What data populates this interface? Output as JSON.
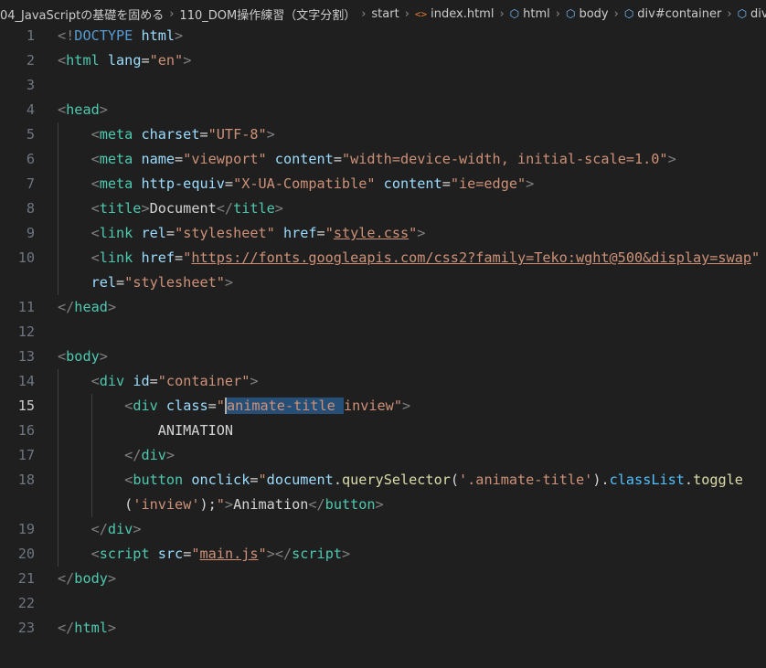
{
  "breadcrumb": [
    {
      "label": "04_JavaScriptの基礎を固める",
      "icon": ""
    },
    {
      "label": "110_DOM操作練習（文字分割）",
      "icon": ""
    },
    {
      "label": "start",
      "icon": ""
    },
    {
      "label": "index.html",
      "icon": "html-file-icon"
    },
    {
      "label": "html",
      "icon": "element-icon"
    },
    {
      "label": "body",
      "icon": "element-icon"
    },
    {
      "label": "div#container",
      "icon": "element-icon"
    },
    {
      "label": "div.animate-title",
      "icon": "element-icon"
    }
  ],
  "colors": {
    "background": "#1f1f1f",
    "tag": "#4ec9b0",
    "attribute": "#9cdcfe",
    "string": "#ce9178",
    "punctuation": "#808080",
    "selection": "#264f78"
  },
  "lines": [
    {
      "num": "1",
      "tokens": [
        [
          "punc",
          "<!"
        ],
        [
          "doc",
          "DOCTYPE"
        ],
        [
          "text",
          " "
        ],
        [
          "attr",
          "html"
        ],
        [
          "punc",
          ">"
        ]
      ]
    },
    {
      "num": "2",
      "tokens": [
        [
          "punc",
          "<"
        ],
        [
          "tag",
          "html"
        ],
        [
          "text",
          " "
        ],
        [
          "attr",
          "lang"
        ],
        [
          "text",
          "="
        ],
        [
          "str",
          "\"en\""
        ],
        [
          "punc",
          ">"
        ]
      ]
    },
    {
      "num": "3",
      "tokens": []
    },
    {
      "num": "4",
      "tokens": [
        [
          "punc",
          "<"
        ],
        [
          "tag",
          "head"
        ],
        [
          "punc",
          ">"
        ]
      ]
    },
    {
      "num": "5",
      "tokens": [
        [
          "text",
          "    "
        ],
        [
          "punc",
          "<"
        ],
        [
          "tag",
          "meta"
        ],
        [
          "text",
          " "
        ],
        [
          "attr",
          "charset"
        ],
        [
          "text",
          "="
        ],
        [
          "str",
          "\"UTF-8\""
        ],
        [
          "punc",
          ">"
        ]
      ]
    },
    {
      "num": "6",
      "tokens": [
        [
          "text",
          "    "
        ],
        [
          "punc",
          "<"
        ],
        [
          "tag",
          "meta"
        ],
        [
          "text",
          " "
        ],
        [
          "attr",
          "name"
        ],
        [
          "text",
          "="
        ],
        [
          "str",
          "\"viewport\""
        ],
        [
          "text",
          " "
        ],
        [
          "attr",
          "content"
        ],
        [
          "text",
          "="
        ],
        [
          "str",
          "\"width=device-width, initial-scale=1.0\""
        ],
        [
          "punc",
          ">"
        ]
      ]
    },
    {
      "num": "7",
      "tokens": [
        [
          "text",
          "    "
        ],
        [
          "punc",
          "<"
        ],
        [
          "tag",
          "meta"
        ],
        [
          "text",
          " "
        ],
        [
          "attr",
          "http-equiv"
        ],
        [
          "text",
          "="
        ],
        [
          "str",
          "\"X-UA-Compatible\""
        ],
        [
          "text",
          " "
        ],
        [
          "attr",
          "content"
        ],
        [
          "text",
          "="
        ],
        [
          "str",
          "\"ie=edge\""
        ],
        [
          "punc",
          ">"
        ]
      ]
    },
    {
      "num": "8",
      "tokens": [
        [
          "text",
          "    "
        ],
        [
          "punc",
          "<"
        ],
        [
          "tag",
          "title"
        ],
        [
          "punc",
          ">"
        ],
        [
          "text",
          "Document"
        ],
        [
          "punc",
          "</"
        ],
        [
          "tag",
          "title"
        ],
        [
          "punc",
          ">"
        ]
      ]
    },
    {
      "num": "9",
      "tokens": [
        [
          "text",
          "    "
        ],
        [
          "punc",
          "<"
        ],
        [
          "tag",
          "link"
        ],
        [
          "text",
          " "
        ],
        [
          "attr",
          "rel"
        ],
        [
          "text",
          "="
        ],
        [
          "str",
          "\"stylesheet\""
        ],
        [
          "text",
          " "
        ],
        [
          "attr",
          "href"
        ],
        [
          "text",
          "="
        ],
        [
          "str",
          "\""
        ],
        [
          "strlink",
          "style.css"
        ],
        [
          "str",
          "\""
        ],
        [
          "punc",
          ">"
        ]
      ]
    },
    {
      "num": "10",
      "tokens": [
        [
          "text",
          "    "
        ],
        [
          "punc",
          "<"
        ],
        [
          "tag",
          "link"
        ],
        [
          "text",
          " "
        ],
        [
          "attr",
          "href"
        ],
        [
          "text",
          "="
        ],
        [
          "str",
          "\""
        ],
        [
          "strlink",
          "https://fonts.googleapis.com/css2?family=Teko:wght@500&display=swap"
        ],
        [
          "str",
          "\""
        ]
      ]
    },
    {
      "num": "",
      "tokens": [
        [
          "text",
          "    "
        ],
        [
          "attr",
          "rel"
        ],
        [
          "text",
          "="
        ],
        [
          "str",
          "\"stylesheet\""
        ],
        [
          "punc",
          ">"
        ]
      ]
    },
    {
      "num": "11",
      "tokens": [
        [
          "punc",
          "</"
        ],
        [
          "tag",
          "head"
        ],
        [
          "punc",
          ">"
        ]
      ]
    },
    {
      "num": "12",
      "tokens": []
    },
    {
      "num": "13",
      "tokens": [
        [
          "punc",
          "<"
        ],
        [
          "tag",
          "body"
        ],
        [
          "punc",
          ">"
        ]
      ]
    },
    {
      "num": "14",
      "tokens": [
        [
          "text",
          "    "
        ],
        [
          "punc",
          "<"
        ],
        [
          "tag",
          "div"
        ],
        [
          "text",
          " "
        ],
        [
          "attr",
          "id"
        ],
        [
          "text",
          "="
        ],
        [
          "str",
          "\"container\""
        ],
        [
          "punc",
          ">"
        ]
      ]
    },
    {
      "num": "15",
      "active": true,
      "tokens": [
        [
          "text",
          "        "
        ],
        [
          "punc",
          "<"
        ],
        [
          "tag",
          "div"
        ],
        [
          "text",
          " "
        ],
        [
          "attr",
          "class"
        ],
        [
          "text",
          "="
        ],
        [
          "str",
          "\""
        ],
        [
          "cursor",
          ""
        ],
        [
          "strsel",
          "animate-title "
        ],
        [
          "str",
          "inview\""
        ],
        [
          "punc",
          ">"
        ]
      ]
    },
    {
      "num": "16",
      "tokens": [
        [
          "text",
          "            "
        ],
        [
          "text",
          "ANIMATION"
        ]
      ]
    },
    {
      "num": "17",
      "tokens": [
        [
          "text",
          "        "
        ],
        [
          "punc",
          "</"
        ],
        [
          "tag",
          "div"
        ],
        [
          "punc",
          ">"
        ]
      ]
    },
    {
      "num": "18",
      "tokens": [
        [
          "text",
          "        "
        ],
        [
          "punc",
          "<"
        ],
        [
          "tag",
          "button"
        ],
        [
          "text",
          " "
        ],
        [
          "attr",
          "onclick"
        ],
        [
          "text",
          "="
        ],
        [
          "str",
          "\""
        ],
        [
          "attr",
          "document"
        ],
        [
          "text",
          "."
        ],
        [
          "fn",
          "querySelector"
        ],
        [
          "text",
          "("
        ],
        [
          "str",
          "'.animate-title'"
        ],
        [
          "text",
          ")."
        ],
        [
          "prop",
          "classList"
        ],
        [
          "text",
          "."
        ],
        [
          "fn",
          "toggle"
        ]
      ]
    },
    {
      "num": "",
      "tokens": [
        [
          "text",
          "        "
        ],
        [
          "text",
          "("
        ],
        [
          "str",
          "'inview'"
        ],
        [
          "text",
          ");"
        ],
        [
          "str",
          "\""
        ],
        [
          "punc",
          ">"
        ],
        [
          "text",
          "Animation"
        ],
        [
          "punc",
          "</"
        ],
        [
          "tag",
          "button"
        ],
        [
          "punc",
          ">"
        ]
      ]
    },
    {
      "num": "19",
      "tokens": [
        [
          "text",
          "    "
        ],
        [
          "punc",
          "</"
        ],
        [
          "tag",
          "div"
        ],
        [
          "punc",
          ">"
        ]
      ]
    },
    {
      "num": "20",
      "tokens": [
        [
          "text",
          "    "
        ],
        [
          "punc",
          "<"
        ],
        [
          "tag",
          "script"
        ],
        [
          "text",
          " "
        ],
        [
          "attr",
          "src"
        ],
        [
          "text",
          "="
        ],
        [
          "str",
          "\""
        ],
        [
          "strlink",
          "main.js"
        ],
        [
          "str",
          "\""
        ],
        [
          "punc",
          "></"
        ],
        [
          "tag",
          "script"
        ],
        [
          "punc",
          ">"
        ]
      ]
    },
    {
      "num": "21",
      "tokens": [
        [
          "punc",
          "</"
        ],
        [
          "tag",
          "body"
        ],
        [
          "punc",
          ">"
        ]
      ]
    },
    {
      "num": "22",
      "tokens": []
    },
    {
      "num": "23",
      "tokens": [
        [
          "punc",
          "</"
        ],
        [
          "tag",
          "html"
        ],
        [
          "punc",
          ">"
        ]
      ]
    }
  ]
}
